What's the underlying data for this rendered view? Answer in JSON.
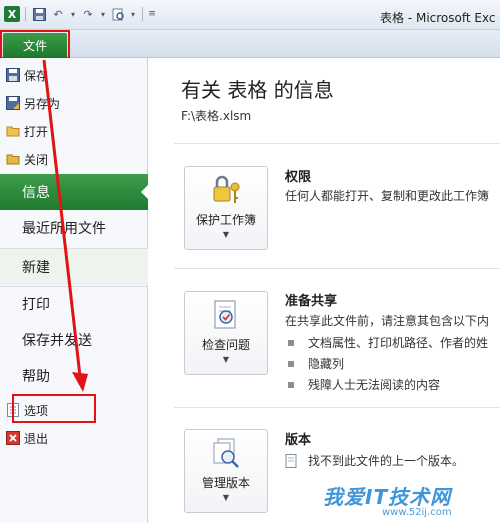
{
  "window": {
    "title": "表格 - Microsoft Exc",
    "app_logo": "X"
  },
  "qat": {
    "icons": [
      "excel-logo",
      "save-icon",
      "undo-icon",
      "redo-icon",
      "print-preview-icon",
      "customize-icon"
    ]
  },
  "file_tab": {
    "label": "文件"
  },
  "nav": {
    "save": "保存",
    "save_as": "另存为",
    "open": "打开",
    "close": "关闭",
    "info": "信息",
    "recent": "最近所用文件",
    "new": "新建",
    "print": "打印",
    "save_send": "保存并发送",
    "help": "帮助",
    "options": "选项",
    "exit": "退出"
  },
  "main": {
    "title": "有关 表格 的信息",
    "path": "F:\\表格.xlsm",
    "permissions": {
      "button": "保护工作簿",
      "title": "权限",
      "desc": "任何人都能打开、复制和更改此工作簿"
    },
    "prepare": {
      "button": "检查问题",
      "title": "准备共享",
      "desc": "在共享此文件前，请注意其包含以下内",
      "items": [
        "文档属性、打印机路径、作者的姓",
        "隐藏列",
        "残障人士无法阅读的内容"
      ]
    },
    "versions": {
      "button": "管理版本",
      "title": "版本",
      "desc": "找不到此文件的上一个版本。"
    }
  },
  "watermark": {
    "text": "我爱IT技术网",
    "sub": "www.52ij.com"
  },
  "colors": {
    "accent_green": "#1f7b30",
    "highlight_red": "#e01414"
  }
}
